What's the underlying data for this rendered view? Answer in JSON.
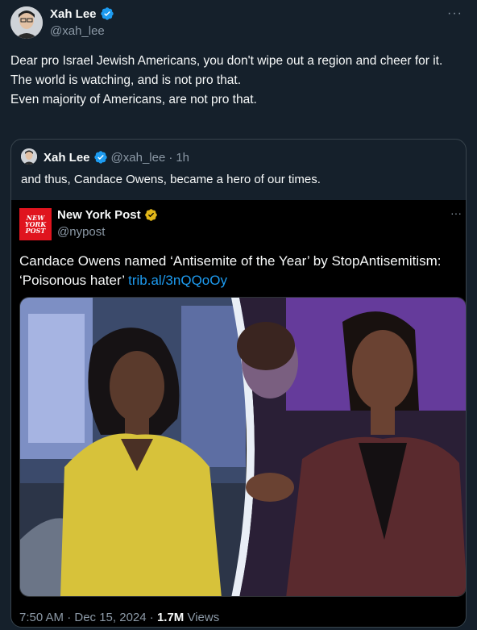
{
  "tweet": {
    "author_name": "Xah Lee",
    "author_handle": "@xah_lee",
    "more_label": "···",
    "lines": [
      "Dear pro Israel Jewish Americans, you don't wipe out a region and cheer for it.",
      "The world is watching, and is not pro that.",
      "Even majority of Americans, are not pro that."
    ]
  },
  "quote": {
    "author_name": "Xah Lee",
    "author_handle": "@xah_lee",
    "separator": "·",
    "time": "1h",
    "text": "and thus, Candace Owens, became a hero of our times."
  },
  "embed": {
    "logo_lines": [
      "NEW",
      "YORK",
      "POST"
    ],
    "author_name": "New York Post",
    "author_handle": "@nypost",
    "more_label": "···",
    "text": "Candace Owens named ‘Antisemite of the Year’ by StopAntisemitism: ‘Poisonous hater’ ",
    "link": "trib.al/3nQQoOy",
    "timestamp": "7:50 AM · Dec 15, 2024 · ",
    "views_count": "1.7M",
    "views_label": " Views"
  },
  "colors": {
    "background": "#15202b",
    "verified_blue": "#1d9bf0",
    "verified_gold": "#e2b719",
    "nyp_red": "#e0141e"
  }
}
